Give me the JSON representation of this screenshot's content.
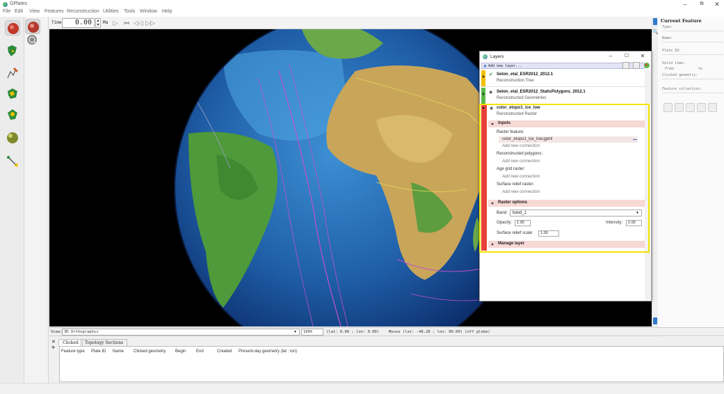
{
  "app": {
    "title": "GPlates"
  },
  "menu": [
    "File",
    "Edit",
    "View",
    "Features",
    "Reconstruction",
    "Utilities",
    "Tools",
    "Window",
    "Help"
  ],
  "timebar": {
    "label": "Time",
    "value": "0.00",
    "unit": "Ma"
  },
  "layers_window": {
    "title": "Layers",
    "add_layer": "Add new layer...",
    "layers": [
      {
        "name": "Seton_etal_ESR2012_2012.1",
        "type": "Reconstruction Tree",
        "color": "#f0c000"
      },
      {
        "name": "Seton_etal_ESR2012_StaticPolygons_2012.1",
        "type": "Reconstructed Geometries",
        "color": "#58b848"
      },
      {
        "name": "color_etopo1_ice_low",
        "type": "Reconstructed Raster",
        "color": "#e8413a"
      }
    ],
    "inputs": {
      "heading": "Inputs",
      "raster_feature_label": "Raster feature:",
      "raster_feature_file": "color_etopo1_ice_low.gpml",
      "add_new": "Add new connection",
      "reconstructed_polygons_label": "Reconstructed polygons:",
      "age_grid_label": "Age grid raster:",
      "surface_relief_label": "Surface relief raster:"
    },
    "raster_options": {
      "heading": "Raster options",
      "band_label": "Band:",
      "band_value": "band_1",
      "opacity_label": "Opacity:",
      "opacity_value": "1.00",
      "intensity_label": "Intensity:",
      "intensity_value": "1.00",
      "relief_label": "Surface relief scale:",
      "relief_value": "1.00"
    },
    "manage": "Manage layer"
  },
  "right_panel": {
    "title": "Current Feature",
    "type_label": "Type:",
    "name_label": "Name:",
    "plate_label": "Plate ID:",
    "valid_label": "Valid time:",
    "from_label": "From:",
    "to_label": "to",
    "clicked_label": "Clicked geometry:",
    "collection_label": "Feature collection:"
  },
  "statusbar": {
    "view_label": "View:",
    "view_value": "3D Orthographic",
    "zoom": "100%",
    "center": "(lat: 0.00 ; lon: 0.00)",
    "mouse": "Mouse (lat: -48.28 ; lon: 90.00) (off globe)"
  },
  "bottom": {
    "tabs": [
      "Clicked",
      "Topology Sections"
    ],
    "columns": [
      "Feature type",
      "Plate ID",
      "Name",
      "Clicked geometry",
      "Begin",
      "End",
      "Created",
      "Present-day geometry (lat : lon)"
    ]
  }
}
